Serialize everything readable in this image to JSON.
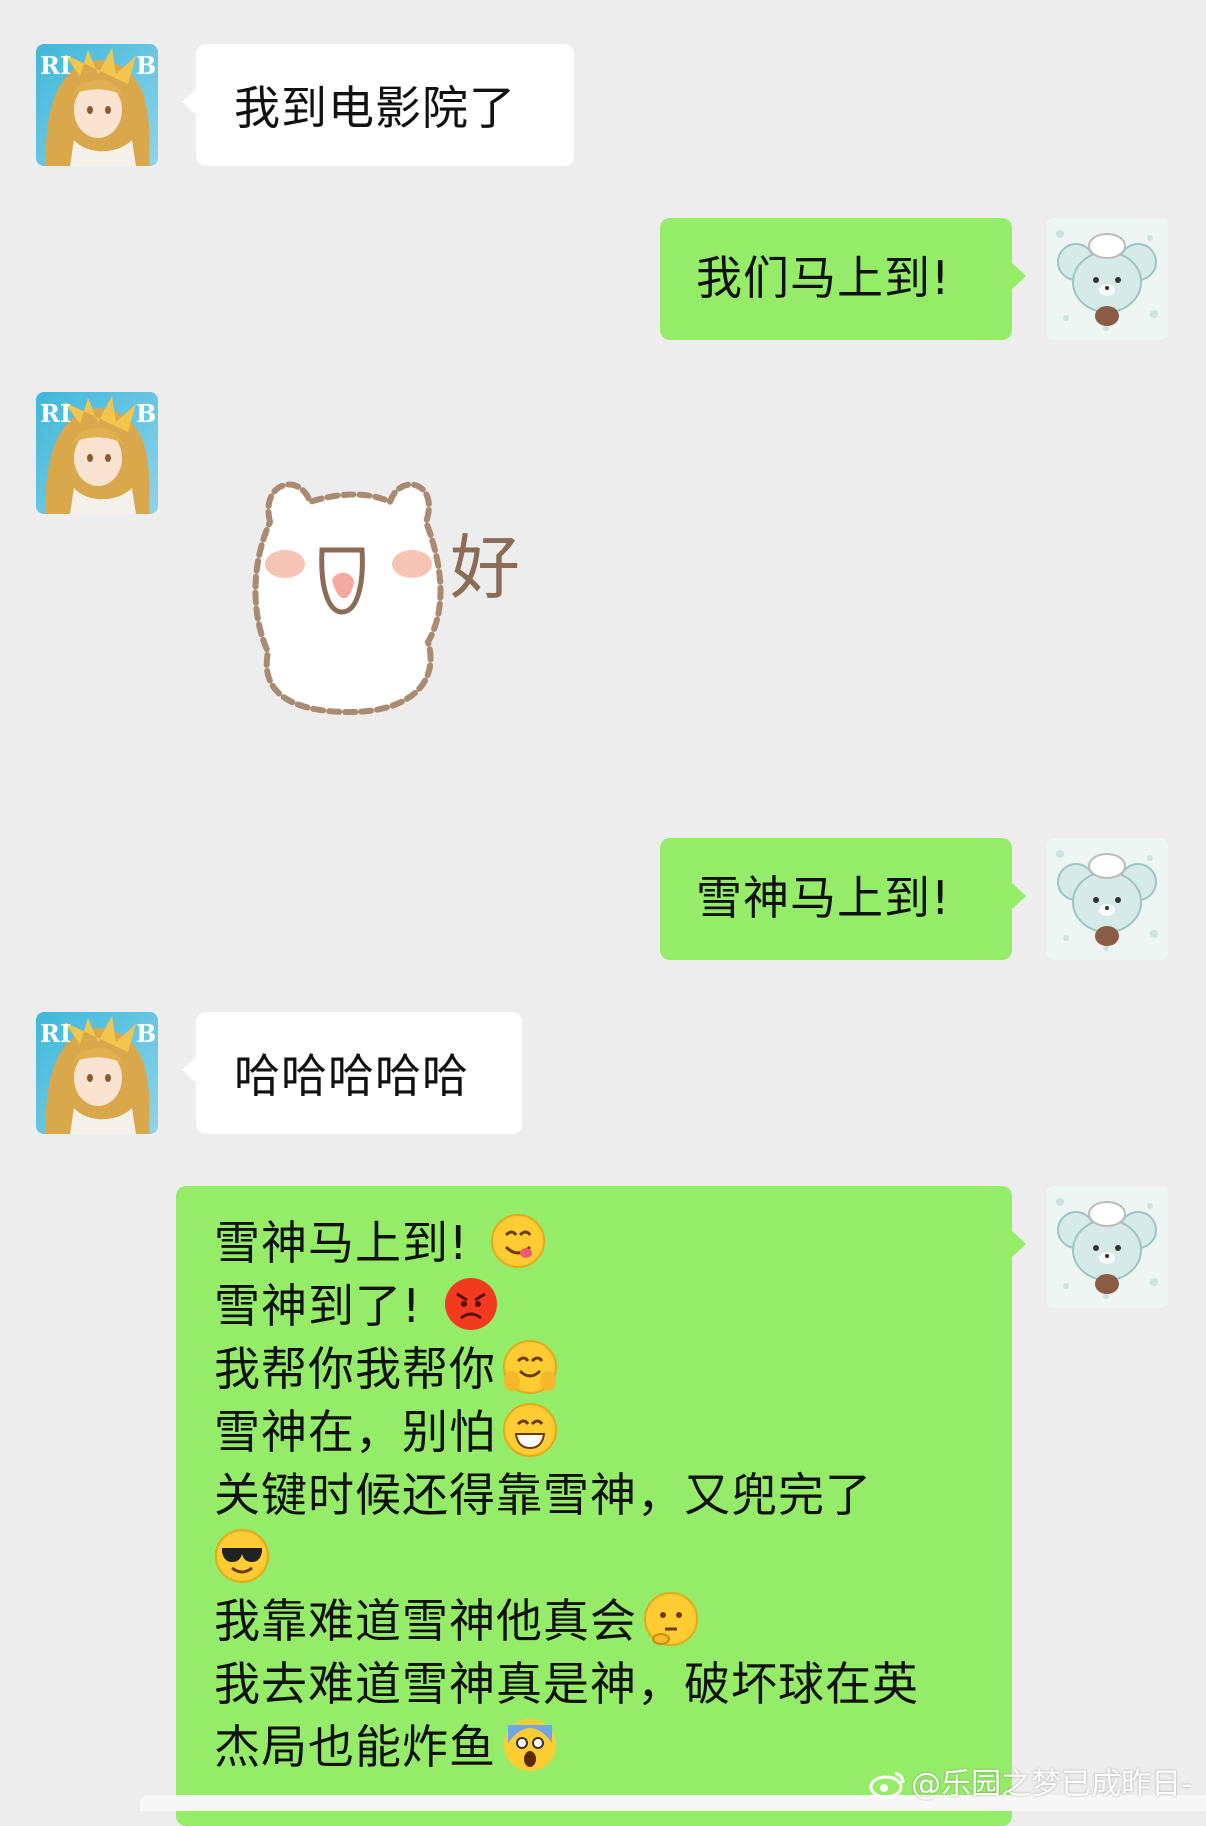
{
  "messages": [
    {
      "side": "left",
      "text": "我到电影院了"
    },
    {
      "side": "right",
      "text": "我们马上到!"
    },
    {
      "side": "left",
      "sticker": "bear-sticker",
      "sticker_text": "好"
    },
    {
      "side": "right",
      "text": "雪神马上到!"
    },
    {
      "side": "left",
      "text": "哈哈哈哈哈"
    },
    {
      "side": "right",
      "lines": [
        {
          "text": "雪神马上到! ",
          "emoji": "yum-face-emoji"
        },
        {
          "text": "雪神到了! ",
          "emoji": "angry-face-emoji"
        },
        {
          "text": "我帮你我帮你",
          "emoji": "hug-face-emoji"
        },
        {
          "text": "雪神在，别怕",
          "emoji": "grin-face-emoji"
        },
        {
          "text": "关键时候还得靠雪神，又兜完了",
          "emoji": ""
        },
        {
          "text": "",
          "emoji": "sunglasses-face-emoji"
        },
        {
          "text": "我靠难道雪神他真会",
          "emoji": "thinking-face-emoji"
        },
        {
          "text": "我去难道雪神真是神，破坏球在英",
          "emoji": ""
        },
        {
          "text": "杰局也能炸鱼",
          "emoji": "scream-face-emoji"
        }
      ]
    }
  ],
  "avatars": {
    "left": "anime-girl-avatar",
    "right": "bear-chef-avatar"
  },
  "watermark": "@乐园之梦已成昨日-",
  "colors": {
    "background": "#ededed",
    "bubble_left": "#ffffff",
    "bubble_right": "#95ec69"
  }
}
